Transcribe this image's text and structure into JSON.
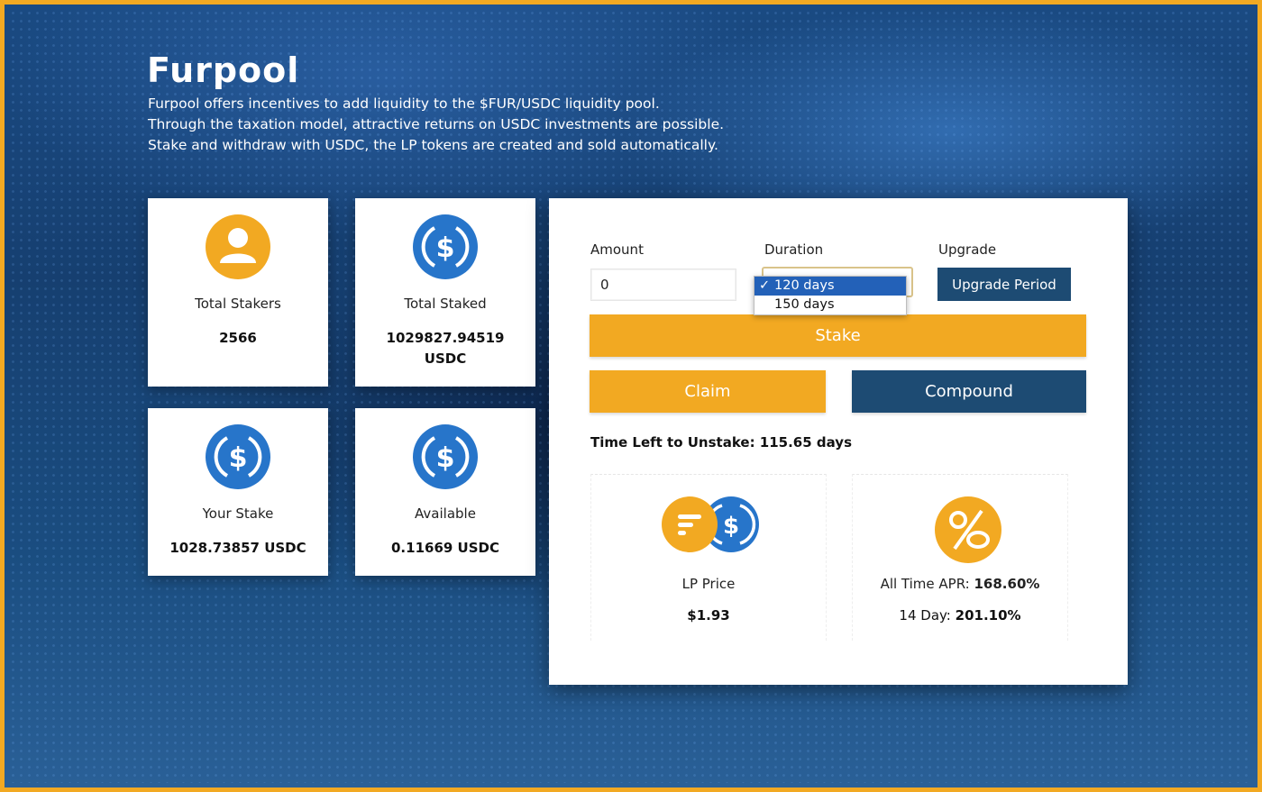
{
  "app": {
    "logo": "Furpool",
    "intro_lines": [
      "Furpool offers incentives to add liquidity to the $FUR/USDC liquidity pool.",
      "Through the taxation model, attractive returns on USDC investments are possible.",
      "Stake and withdraw with USDC, the LP tokens are created and sold automatically."
    ]
  },
  "stats": [
    {
      "label": "Total Stakers",
      "value": "2566",
      "icon": "user-icon"
    },
    {
      "label": "Total Staked",
      "value_line1": "1029827.94519",
      "value_line2": "USDC",
      "icon": "usdc-icon"
    },
    {
      "label": "Your Stake",
      "value": "1028.73857 USDC",
      "icon": "usdc-icon"
    },
    {
      "label": "Available",
      "value": "0.11669 USDC",
      "icon": "usdc-icon"
    }
  ],
  "form": {
    "amount_label": "Amount",
    "amount_value": "0",
    "duration_label": "Duration",
    "duration_selected": "120 days",
    "duration_options": [
      "120 days",
      "150 days"
    ],
    "checkmark": "✓",
    "upgrade_label": "Upgrade",
    "upgrade_button": "Upgrade Period",
    "stake_button": "Stake",
    "claim_button": "Claim",
    "compound_button": "Compound",
    "time_left": "Time Left to Unstake: 115.65 days"
  },
  "lp": {
    "label": "LP Price",
    "value": "$1.93",
    "icon": "fur-usdc-icon"
  },
  "apr": {
    "all_time_label": "All Time APR: ",
    "all_time_value": "168.60%",
    "day14_label": "14 Day: ",
    "day14_value": "201.10%",
    "icon": "percent-icon"
  },
  "colors": {
    "accent": "#f2a922",
    "navy": "#1d4b73",
    "usdc_blue": "#2775ca",
    "selected": "#2361b8"
  }
}
